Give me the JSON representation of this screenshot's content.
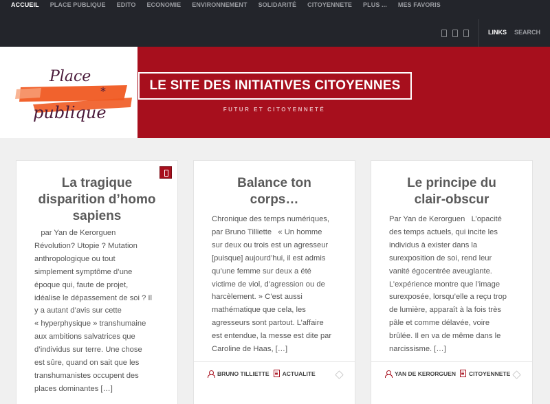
{
  "nav": {
    "items": [
      "ACCUEIL",
      "PLACE PUBLIQUE",
      "EDITO",
      "ECONOMIE",
      "ENVIRONNEMENT",
      "SOLIDARITÉ",
      "CITOYENNETE",
      "PLUS ...",
      "MES FAVORIS"
    ],
    "active_index": 0,
    "links": "LINKS",
    "search": "SEARCH",
    "social_icons": [
      "facebook-icon",
      "twitter-icon",
      "rss-icon"
    ]
  },
  "header": {
    "logo_text": [
      "Place",
      "publique"
    ],
    "tagline": "LE SITE DES INITIATIVES CITOYENNES",
    "subtitle": "FUTUR ET CITOYENNETÉ",
    "colors": {
      "brand": "#a70f1d",
      "topbar": "#23252b",
      "logo_orange": "#f05a22",
      "logo_ink": "#4a1a3a"
    }
  },
  "cards": [
    {
      "title": [
        "La tragique",
        "disparition d’homo",
        "sapiens"
      ],
      "pinned": true,
      "excerpt": [
        "   par Yan de Kerorguen",
        "Révolution? Utopie ? Mutation",
        "anthropologique ou tout",
        "simplement symptôme d’une",
        "époque qui, faute de projet,",
        "idéalise le dépassement de soi ? Il",
        "y a autant d’avis sur cette",
        "« hyperphysique » transhumaine",
        "aux ambitions salvatrices que",
        "d’individus sur terre. Une chose",
        "est sûre, quand on sait que les",
        "transhumanistes occupent des",
        "places dominantes […]"
      ],
      "author": "",
      "category": ""
    },
    {
      "title": [
        "Balance ton",
        "corps…"
      ],
      "pinned": false,
      "excerpt": [
        "Chronique des temps numériques,",
        "par Bruno Tilliette   « Un homme",
        "sur deux ou trois est un agresseur",
        "[puisque] aujourd’hui, il est admis",
        "qu’une femme sur deux a été",
        "victime de viol, d’agression ou de",
        "harcèlement. » C’est aussi",
        "mathématique que cela, les",
        "agresseurs sont partout. L’affaire",
        "est entendue, la messe est dite par",
        "Caroline de Haas, […]"
      ],
      "author": "BRUNO TILLIETTE",
      "category": "ACTUALITE"
    },
    {
      "title": [
        "Le principe du",
        "clair-obscur"
      ],
      "pinned": false,
      "excerpt": [
        "Par Yan de Kerorguen   L’opacité",
        "des temps actuels, qui incite les",
        "individus à exister dans la",
        "surexposition de soi, rend leur",
        "vanité égocentrée aveuglante.",
        "L’expérience montre que l’image",
        "surexposée, lorsqu’elle a reçu trop",
        "de lumière, apparaît à la fois très",
        "pâle et comme délavée, voire",
        "brûlée. Il en va de même dans le",
        "narcissisme. […]"
      ],
      "author": "YAN DE KERORGUEN",
      "category": "CITOYENNETE"
    }
  ]
}
